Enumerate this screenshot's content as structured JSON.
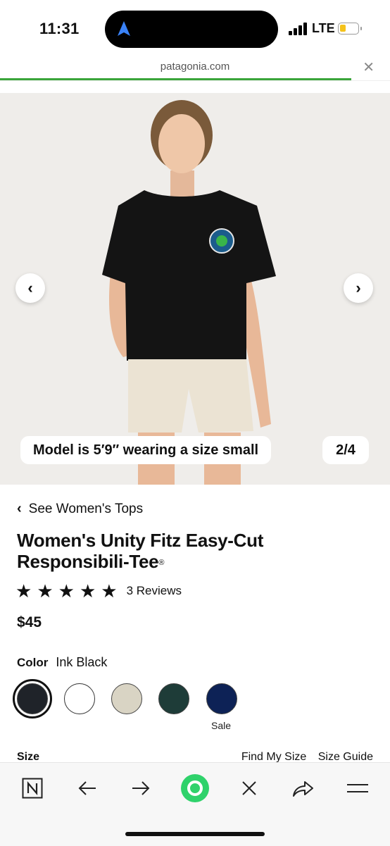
{
  "status_bar": {
    "time": "11:31",
    "network": "LTE"
  },
  "browser": {
    "url": "patagonia.com",
    "load_progress": 0.9
  },
  "gallery": {
    "caption": "Model is 5′9″ wearing a size small",
    "counter": "2/4"
  },
  "product": {
    "back_link": "See Women's Tops",
    "title": "Women's Unity Fitz Easy-Cut Responsibili-Tee",
    "title_mark": "®",
    "rating_stars": 5,
    "reviews": "3 Reviews",
    "price": "$45",
    "color_label": "Color",
    "color_value": "Ink Black",
    "swatches": [
      {
        "name": "Ink Black",
        "hex": "#1f2329",
        "selected": true
      },
      {
        "name": "White",
        "hex": "#ffffff",
        "selected": false
      },
      {
        "name": "Beige",
        "hex": "#d9d4c4",
        "selected": false
      },
      {
        "name": "Dark Green",
        "hex": "#1e3c38",
        "selected": false
      },
      {
        "name": "Navy",
        "hex": "#0d2256",
        "selected": false
      }
    ],
    "sale_label": "Sale",
    "size_label": "Size",
    "find_my_size": "Find My Size",
    "size_guide": "Size Guide"
  },
  "toolbar": {
    "icons": [
      "n-app-icon",
      "back-arrow-icon",
      "forward-arrow-icon",
      "assistant-orb-icon",
      "close-icon",
      "share-icon",
      "menu-icon"
    ]
  },
  "colors": {
    "accent_progress": "#3aa53a",
    "assistant_green": "#2fd26b"
  }
}
